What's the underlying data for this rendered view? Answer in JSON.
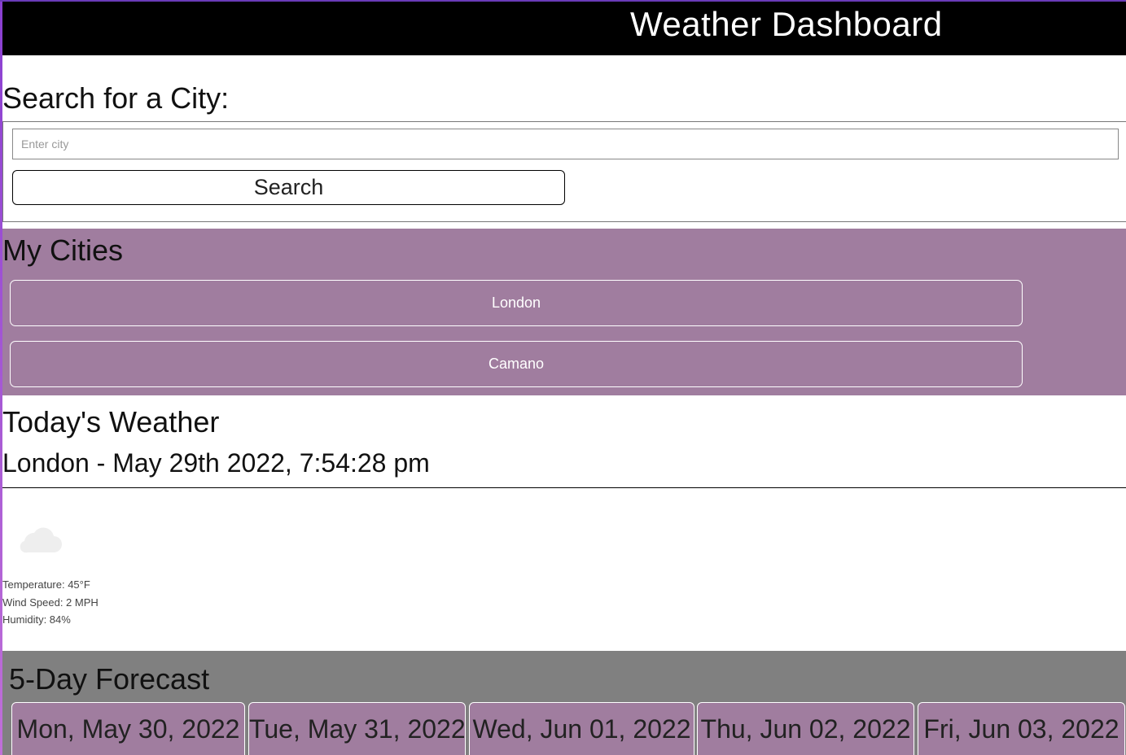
{
  "header": {
    "title": "Weather Dashboard"
  },
  "search": {
    "heading": "Search for a City:",
    "placeholder": "Enter city",
    "button_label": "Search"
  },
  "cities": {
    "heading": "My Cities",
    "items": [
      {
        "label": "London"
      },
      {
        "label": "Camano"
      }
    ]
  },
  "today": {
    "heading": "Today's Weather",
    "subheading": "London - May 29th 2022, 7:54:28 pm",
    "icon": "cloud-icon",
    "temperature": "Temperature: 45°F",
    "wind": "Wind Speed: 2 MPH",
    "humidity": "Humidity: 84%"
  },
  "forecast": {
    "heading": "5-Day Forecast",
    "days": [
      {
        "date": "Mon, May 30, 2022"
      },
      {
        "date": "Tue, May 31, 2022"
      },
      {
        "date": "Wed, Jun 01, 2022"
      },
      {
        "date": "Thu, Jun 02, 2022"
      },
      {
        "date": "Fri, Jun 03, 2022"
      }
    ]
  },
  "colors": {
    "header_bg": "#000000",
    "cities_bg": "#a07d9f",
    "forecast_bg": "#808080",
    "card_bg": "#a07d9f"
  }
}
